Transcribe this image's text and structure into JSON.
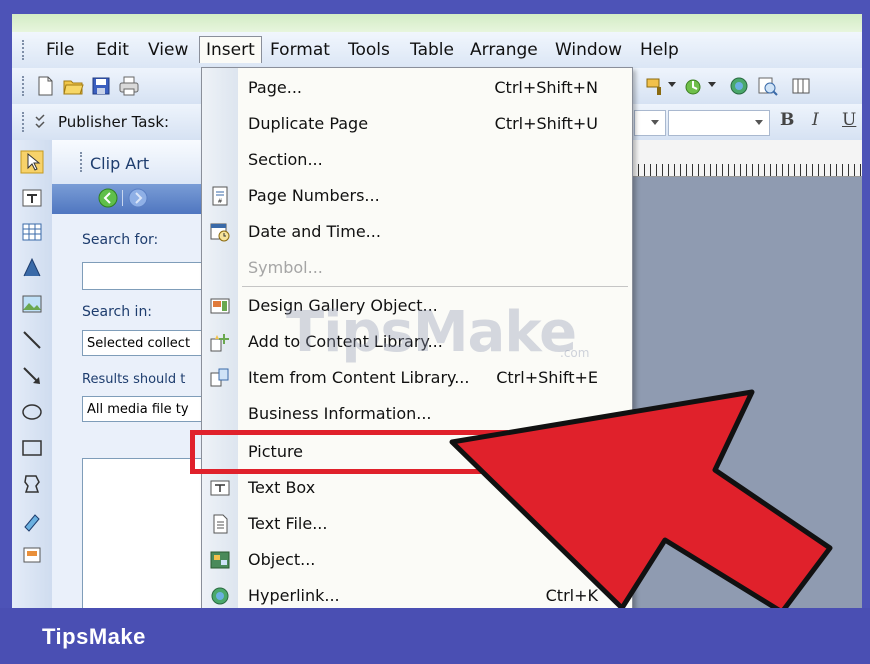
{
  "menubar": {
    "items": [
      {
        "label": "File"
      },
      {
        "label": "Edit"
      },
      {
        "label": "View"
      },
      {
        "label": "Insert",
        "active": true
      },
      {
        "label": "Format"
      },
      {
        "label": "Tools"
      },
      {
        "label": "Table"
      },
      {
        "label": "Arrange"
      },
      {
        "label": "Window"
      },
      {
        "label": "Help"
      }
    ]
  },
  "toolbar2": {
    "publisher_tasks": "Publisher Task:"
  },
  "taskpane": {
    "title": "Clip Art",
    "search_for_label": "Search for:",
    "search_in_label": "Search in:",
    "search_in_value": "Selected collect",
    "results_label": "Results should t",
    "results_value": "All media file ty"
  },
  "insert_menu": {
    "items": [
      {
        "label": "Page...",
        "shortcut": "Ctrl+Shift+N",
        "icon": ""
      },
      {
        "label": "Duplicate Page",
        "shortcut": "Ctrl+Shift+U",
        "icon": ""
      },
      {
        "label": "Section...",
        "shortcut": "",
        "icon": ""
      },
      {
        "label": "Page Numbers...",
        "shortcut": "",
        "icon": "page-numbers-icon"
      },
      {
        "label": "Date and Time...",
        "shortcut": "",
        "icon": "date-time-icon"
      },
      {
        "label": "Symbol...",
        "shortcut": "",
        "icon": "",
        "disabled": true
      },
      {
        "label": "Design Gallery Object...",
        "shortcut": "",
        "icon": "design-gallery-icon"
      },
      {
        "label": "Add to Content Library...",
        "shortcut": "",
        "icon": "add-content-library-icon"
      },
      {
        "label": "Item from Content Library...",
        "shortcut": "Ctrl+Shift+E",
        "icon": "content-library-item-icon"
      },
      {
        "label": "Business Information...",
        "shortcut": "",
        "icon": ""
      },
      {
        "label": "Picture",
        "shortcut": "",
        "icon": ""
      },
      {
        "label": "Text Box",
        "shortcut": "",
        "icon": "text-box-icon"
      },
      {
        "label": "Text File...",
        "shortcut": "",
        "icon": "text-file-icon"
      },
      {
        "label": "Object...",
        "shortcut": "",
        "icon": "object-icon"
      },
      {
        "label": "Hyperlink...",
        "shortcut": "Ctrl+K",
        "icon": "hyperlink-icon"
      }
    ]
  },
  "watermark": {
    "text": "TipsMake",
    "suffix": ".com"
  },
  "footer": {
    "brand": "TipsMake"
  },
  "colors": {
    "highlight": "#e0212b",
    "arrow": "#e0212b",
    "footer": "#4a4fb3"
  }
}
